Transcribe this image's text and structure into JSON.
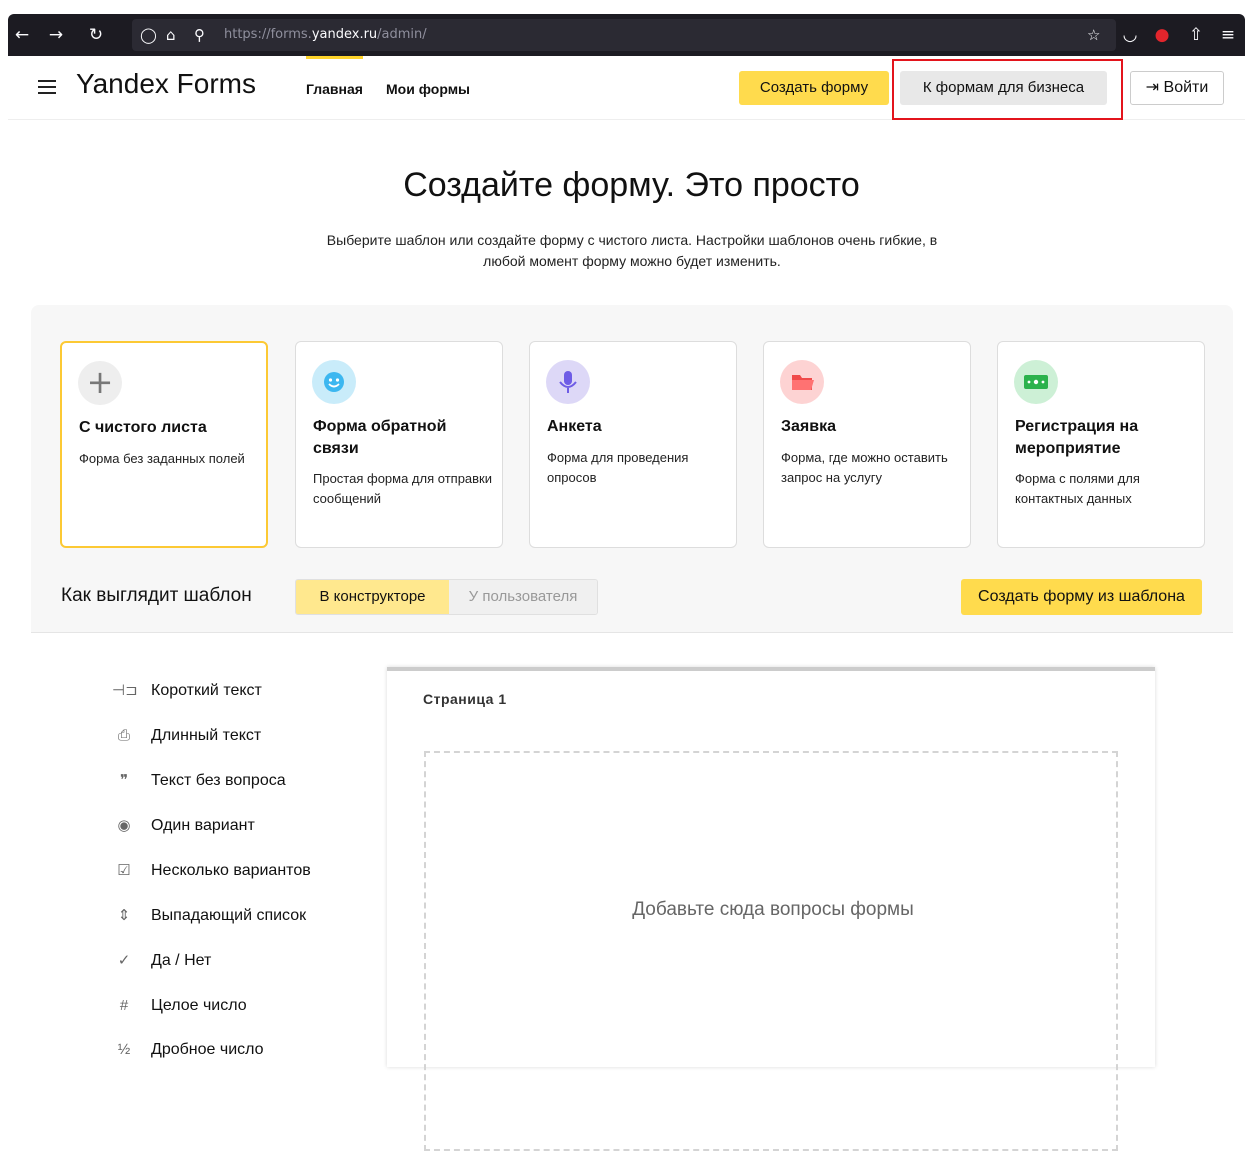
{
  "browser": {
    "url_prefix": "https://forms.",
    "url_domain": "yandex.ru",
    "url_path": "/admin/"
  },
  "header": {
    "logo": "Yandex Forms",
    "nav": [
      {
        "label": "Главная"
      },
      {
        "label": "Мои формы"
      }
    ],
    "create_form_label": "Создать форму",
    "business_label": "К формам для бизнеса",
    "login_label": "Войти"
  },
  "hero": {
    "title": "Создайте форму. Это просто",
    "subtitle": "Выберите шаблон или создайте форму с чистого листа. Настройки шаблонов очень гибкие, в любой момент форму можно будет изменить."
  },
  "templates": [
    {
      "title": "С чистого листа",
      "desc": "Форма без заданных полей",
      "icon": "plus-icon",
      "color": "#eeeeee"
    },
    {
      "title": "Форма обратной связи",
      "desc": "Простая форма для отправки сообщений",
      "icon": "smile-icon",
      "color": "#c9ecfa"
    },
    {
      "title": "Анкета",
      "desc": "Форма для проведения опросов",
      "icon": "microphone-icon",
      "color": "#ddd8f7"
    },
    {
      "title": "Заявка",
      "desc": "Форма, где можно оставить запрос на услугу",
      "icon": "folder-icon",
      "color": "#fdd3d3"
    },
    {
      "title": "Регистрация на мероприятие",
      "desc": "Форма с полями для контактных данных",
      "icon": "ticket-icon",
      "color": "#cdf0d6"
    }
  ],
  "template_preview": {
    "label": "Как выглядит шаблон",
    "tab_constructor": "В конструкторе",
    "tab_user": "У пользователя",
    "create_from_template": "Создать форму из шаблона"
  },
  "palette": [
    {
      "label": "Короткий текст",
      "icon": "short-text-icon",
      "glyph": "⊣⊐"
    },
    {
      "label": "Длинный текст",
      "icon": "long-text-icon",
      "glyph": "⎙"
    },
    {
      "label": "Текст без вопроса",
      "icon": "quote-icon",
      "glyph": "❞"
    },
    {
      "label": "Один вариант",
      "icon": "radio-icon",
      "glyph": "◉"
    },
    {
      "label": "Несколько вариантов",
      "icon": "checkbox-icon",
      "glyph": "☑"
    },
    {
      "label": "Выпадающий список",
      "icon": "dropdown-icon",
      "glyph": "⇕"
    },
    {
      "label": "Да / Нет",
      "icon": "check-icon",
      "glyph": "✓"
    },
    {
      "label": "Целое число",
      "icon": "hash-icon",
      "glyph": "#"
    },
    {
      "label": "Дробное число",
      "icon": "fraction-icon",
      "glyph": "½"
    }
  ],
  "canvas": {
    "page_label": "Страница 1",
    "drop_hint": "Добавьте сюда вопросы формы"
  }
}
